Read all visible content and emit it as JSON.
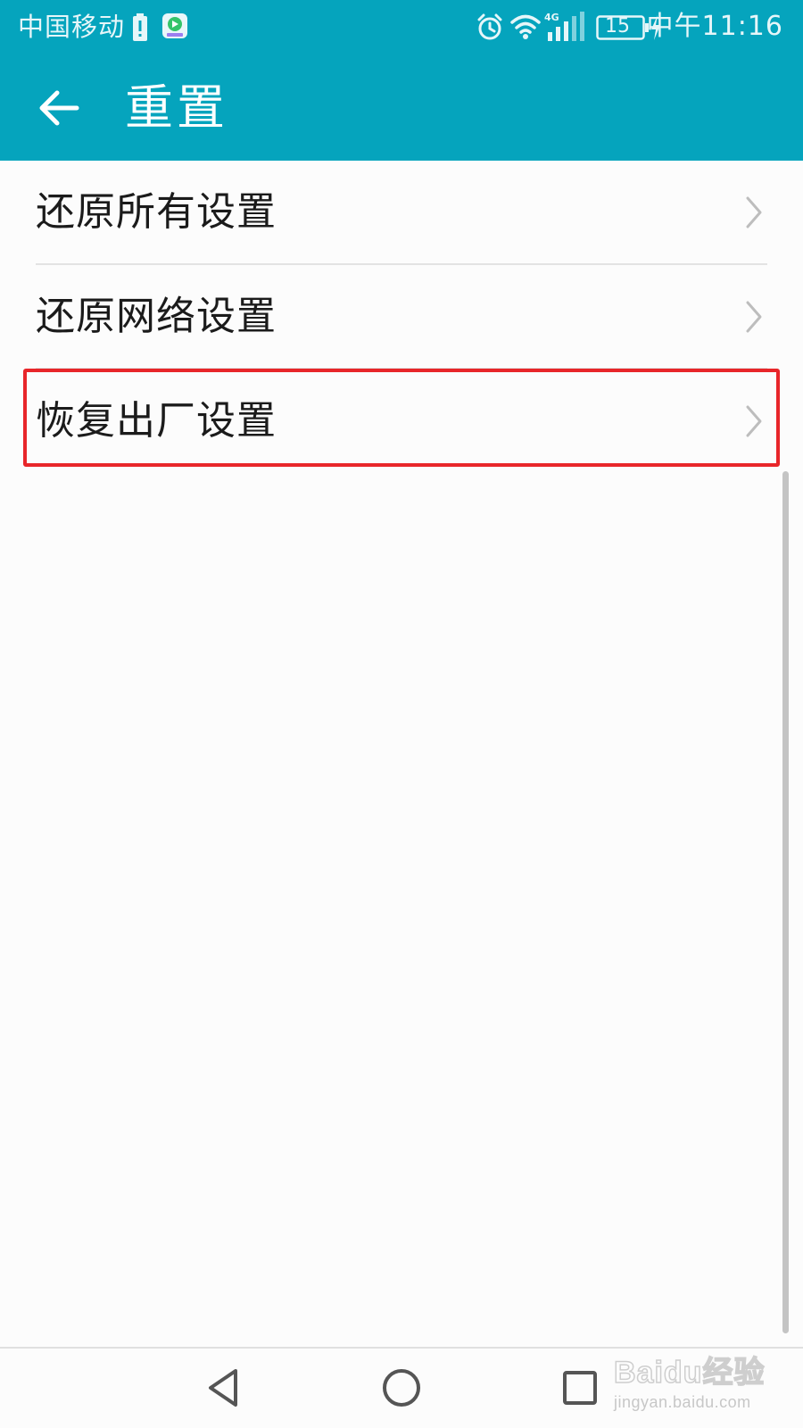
{
  "status_bar": {
    "carrier": "中国移动",
    "battery_level": "15",
    "clock": "中午11:16",
    "icons": [
      "battery-low-icon",
      "video-app-icon",
      "alarm-icon",
      "wifi-icon",
      "signal-4g-icon",
      "battery-icon",
      "charging-icon"
    ]
  },
  "header": {
    "title": "重置",
    "back_icon": "arrow-left-icon"
  },
  "settings_list": {
    "items": [
      {
        "label": "还原所有设置",
        "icon": "chevron-right-icon"
      },
      {
        "label": "还原网络设置",
        "icon": "chevron-right-icon"
      },
      {
        "label": "恢复出厂设置",
        "icon": "chevron-right-icon",
        "highlighted": true
      }
    ]
  },
  "navigation_bar": {
    "icons": [
      "triangle-back-icon",
      "circle-home-icon",
      "square-recents-icon"
    ]
  },
  "watermark": {
    "logo": "Baidu经验",
    "url": "jingyan.baidu.com"
  },
  "colors": {
    "accent": "#05a4bd",
    "highlight_border": "#e8262a",
    "background": "#fcfcfc"
  }
}
